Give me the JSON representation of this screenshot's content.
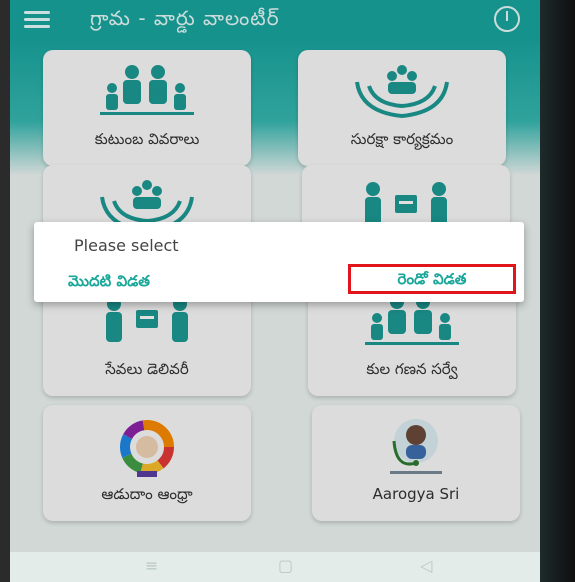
{
  "app": {
    "title": "గ్రామ - వార్డు వాలంటీర్"
  },
  "tiles": [
    {
      "label": "కుటుంబ వివరాలు",
      "icon": "family-icon"
    },
    {
      "label": "సురక్షా కార్యక్రమం",
      "icon": "care-hands-icon"
    },
    {
      "label": "",
      "icon": "care-hands-icon"
    },
    {
      "label": "",
      "icon": "delivery-icon"
    },
    {
      "label": "సేవలు డెలివరీ",
      "icon": "delivery-icon"
    },
    {
      "label": "కుల గణన సర్వే",
      "icon": "family-icon"
    },
    {
      "label": "ఆడుదాం ఆంధ్రా",
      "icon": "sports-logo-icon"
    },
    {
      "label": "Aarogya Sri",
      "icon": "aarogya-logo-icon"
    }
  ],
  "dialog": {
    "title": "Please select",
    "option1": "మొదటి విడత",
    "option2": "రెండో విడత"
  },
  "colors": {
    "primary": "#1aa7a1",
    "highlight": "#e0161c"
  }
}
